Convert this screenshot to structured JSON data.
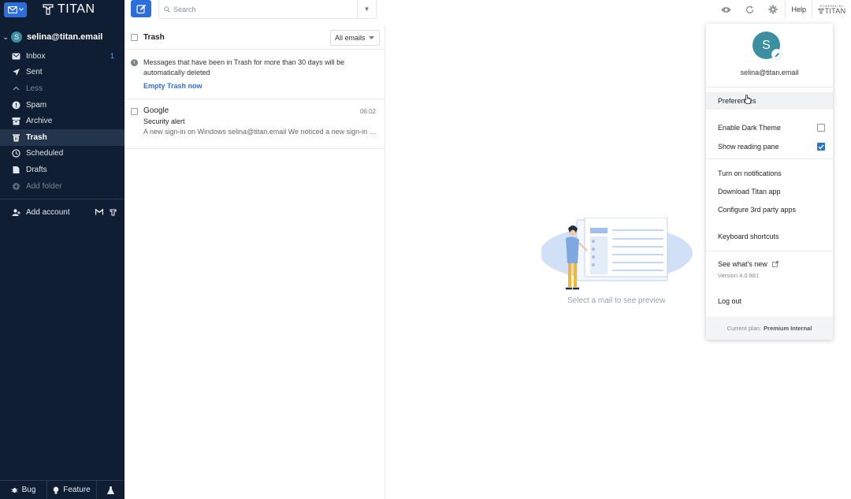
{
  "brand": {
    "name": "TITAN",
    "powered_by": "POWERED BY",
    "powered_name": "TITAN"
  },
  "account": {
    "avatar_letter": "S",
    "email": "selina@titan.email"
  },
  "sidebar": {
    "items": [
      {
        "label": "Inbox",
        "icon": "inbox-icon",
        "badge": "1",
        "state": "normal"
      },
      {
        "label": "Sent",
        "icon": "send-icon",
        "badge": "",
        "state": "normal"
      },
      {
        "label": "Less",
        "icon": "chevron-up-icon",
        "badge": "",
        "state": "dim"
      },
      {
        "label": "Spam",
        "icon": "alert-icon",
        "badge": "",
        "state": "normal"
      },
      {
        "label": "Archive",
        "icon": "archive-icon",
        "badge": "",
        "state": "normal"
      },
      {
        "label": "Trash",
        "icon": "trash-icon",
        "badge": "",
        "state": "active"
      },
      {
        "label": "Scheduled",
        "icon": "clock-icon",
        "badge": "",
        "state": "normal"
      },
      {
        "label": "Drafts",
        "icon": "draft-icon",
        "badge": "",
        "state": "normal"
      },
      {
        "label": "Add folder",
        "icon": "add-folder-icon",
        "badge": "",
        "state": "dim"
      }
    ],
    "add_account": "Add account",
    "bottom": {
      "bug": "Bug",
      "feature": "Feature"
    }
  },
  "search": {
    "placeholder": "Search"
  },
  "topbar": {
    "help": "Help"
  },
  "list": {
    "title": "Trash",
    "filter": "All emails",
    "notice": "Messages that have been in Trash for more than 30 days will be automatically deleted",
    "empty_action": "Empty Trash now",
    "mails": [
      {
        "from": "Google",
        "time": "06:02",
        "subject": "Security alert",
        "snippet": "A new sign-in on Windows selina@titan.email We noticed a new sign-in to your Google Account"
      }
    ]
  },
  "preview": {
    "empty_text": "Select a mail to see preview"
  },
  "menu": {
    "avatar_letter": "S",
    "email": "selina@titan.email",
    "preferences": "Preferences",
    "dark_theme": "Enable Dark Theme",
    "dark_theme_on": false,
    "reading_pane": "Show reading pane",
    "reading_pane_on": true,
    "notifications": "Turn on notifications",
    "download": "Download Titan app",
    "third_party": "Configure 3rd party apps",
    "shortcuts": "Keyboard shortcuts",
    "whats_new": "See what's new",
    "version": "Version 4.0.881",
    "logout": "Log out",
    "plan_label": "Current plan:",
    "plan_name": "Premium Internal"
  },
  "colors": {
    "accent": "#2c6fdc",
    "sidebar_bg": "#0f1e33",
    "avatar": "#3c8fa1"
  }
}
